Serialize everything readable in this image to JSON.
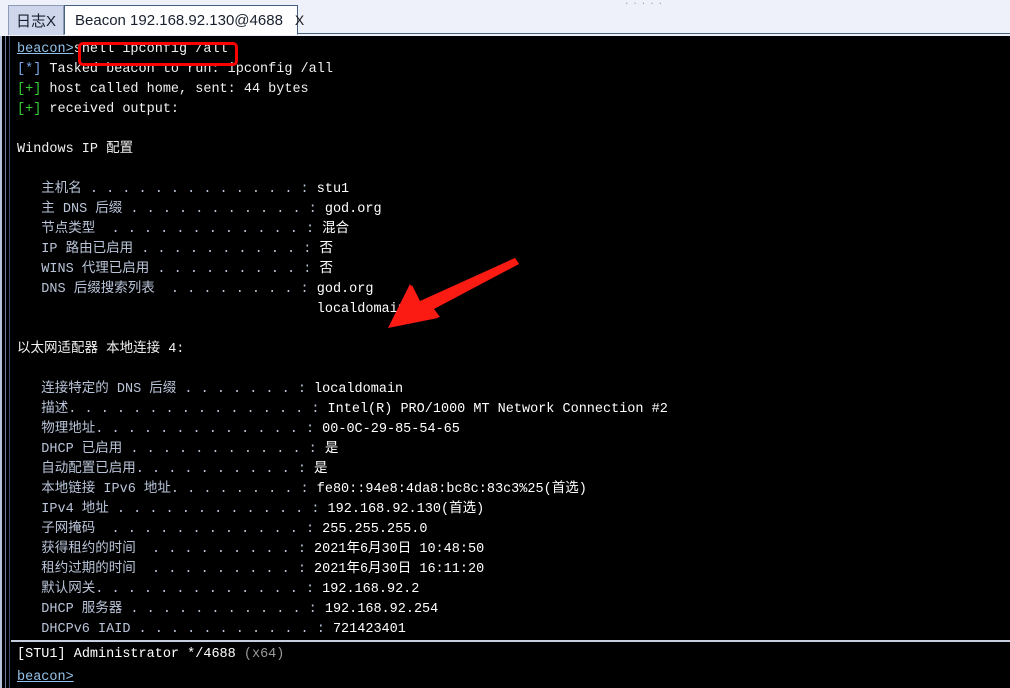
{
  "window": {
    "top_artifact": "....."
  },
  "tabs": [
    {
      "label": "日志X",
      "active": false,
      "name": "tab-log"
    },
    {
      "label": "Beacon 192.168.92.130@4688",
      "close_label": "X",
      "active": true,
      "name": "tab-beacon"
    }
  ],
  "console": {
    "prompt": "beacon>",
    "command": "shell ipconfig /all",
    "lines": [
      {
        "type": "prompt",
        "prompt": "beacon>",
        "text": "shell ipconfig /all"
      },
      {
        "type": "star",
        "tag": "[*]",
        "text": " Tasked beacon to run: ipconfig /all"
      },
      {
        "type": "plus",
        "tag": "[+]",
        "text": " host called home, sent: 44 bytes"
      },
      {
        "type": "plus",
        "tag": "[+]",
        "text": " received output:"
      },
      {
        "type": "blank",
        "text": ""
      },
      {
        "type": "plain",
        "text": "Windows IP 配置"
      },
      {
        "type": "blank",
        "text": ""
      },
      {
        "type": "kv",
        "key": "   主机名 . . . . . . . . . . . . . : ",
        "value": "stu1"
      },
      {
        "type": "kv",
        "key": "   主 DNS 后缀 . . . . . . . . . . . : ",
        "value": "god.org"
      },
      {
        "type": "kv",
        "key": "   节点类型  . . . . . . . . . . . . : ",
        "value": "混合"
      },
      {
        "type": "kv",
        "key": "   IP 路由已启用 . . . . . . . . . . : ",
        "value": "否"
      },
      {
        "type": "kv",
        "key": "   WINS 代理已启用 . . . . . . . . . : ",
        "value": "否"
      },
      {
        "type": "kv",
        "key": "   DNS 后缀搜索列表  . . . . . . . . : ",
        "value": "god.org"
      },
      {
        "type": "cont",
        "text": "                                     localdomain"
      },
      {
        "type": "blank",
        "text": ""
      },
      {
        "type": "plain",
        "text": "以太网适配器 本地连接 4:"
      },
      {
        "type": "blank",
        "text": ""
      },
      {
        "type": "kv",
        "key": "   连接特定的 DNS 后缀 . . . . . . . : ",
        "value": "localdomain"
      },
      {
        "type": "kv",
        "key": "   描述. . . . . . . . . . . . . . . : ",
        "value": "Intel(R) PRO/1000 MT Network Connection #2"
      },
      {
        "type": "kv",
        "key": "   物理地址. . . . . . . . . . . . . : ",
        "value": "00-0C-29-85-54-65"
      },
      {
        "type": "kv",
        "key": "   DHCP 已启用 . . . . . . . . . . . : ",
        "value": "是"
      },
      {
        "type": "kv",
        "key": "   自动配置已启用. . . . . . . . . . : ",
        "value": "是"
      },
      {
        "type": "kv",
        "key": "   本地链接 IPv6 地址. . . . . . . . : ",
        "value": "fe80::94e8:4da8:bc8c:83c3%25(首选)"
      },
      {
        "type": "kv",
        "key": "   IPv4 地址 . . . . . . . . . . . . : ",
        "value": "192.168.92.130(首选)"
      },
      {
        "type": "kv",
        "key": "   子网掩码  . . . . . . . . . . . . : ",
        "value": "255.255.255.0"
      },
      {
        "type": "kv",
        "key": "   获得租约的时间  . . . . . . . . . : ",
        "value": "2021年6月30日 10:48:50"
      },
      {
        "type": "kv",
        "key": "   租约过期的时间  . . . . . . . . . : ",
        "value": "2021年6月30日 16:11:20"
      },
      {
        "type": "kv",
        "key": "   默认网关. . . . . . . . . . . . . : ",
        "value": "192.168.92.2"
      },
      {
        "type": "kv",
        "key": "   DHCP 服务器 . . . . . . . . . . . : ",
        "value": "192.168.92.254"
      },
      {
        "type": "kv",
        "key": "   DHCPv6 IAID . . . . . . . . . . . : ",
        "value": "721423401"
      }
    ]
  },
  "annotations": {
    "command_highlight_color": "#ff0000",
    "arrow_color": "#ff0000"
  },
  "status": {
    "host": "[STU1]",
    "user": "Administrator",
    "process": "*/4688",
    "arch": "(x64)"
  },
  "input": {
    "prompt": "beacon>",
    "value": "",
    "placeholder": ""
  }
}
